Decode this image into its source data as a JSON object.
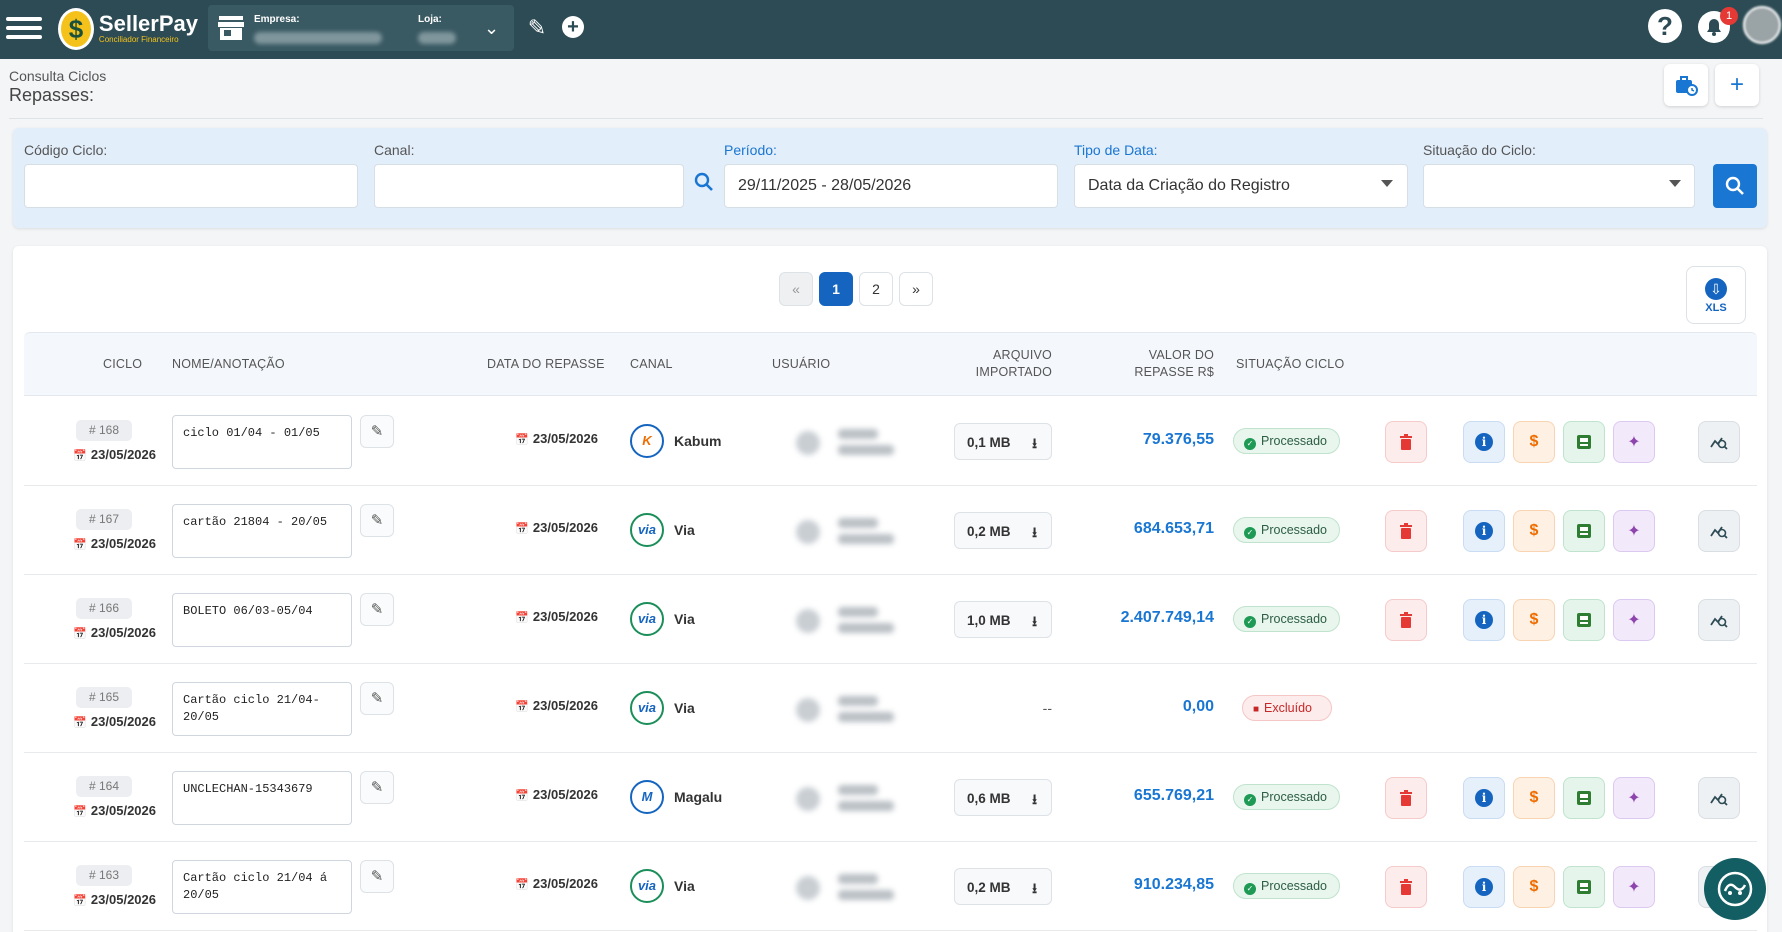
{
  "app": {
    "logo_name": "SellerPay",
    "logo_tagline": "Conciliador Financeiro",
    "empresa_label": "Empresa:",
    "loja_label": "Loja:",
    "notification_count": "1"
  },
  "header": {
    "breadcrumb": "Consulta Ciclos",
    "title": "Repasses:"
  },
  "filters": {
    "codigo_label": "Código Ciclo:",
    "codigo_value": "",
    "canal_label": "Canal:",
    "canal_value": "",
    "periodo_label": "Período:",
    "periodo_value": "29/11/2025 - 28/05/2026",
    "tipo_label": "Tipo de Data:",
    "tipo_value": "Data da Criação do Registro",
    "situacao_label": "Situação do Ciclo:",
    "situacao_value": ""
  },
  "pagination": {
    "prev": "«",
    "pages": [
      "1",
      "2"
    ],
    "next": "»",
    "current": "1"
  },
  "export": {
    "label": "XLS"
  },
  "table": {
    "headers": {
      "ciclo": "CICLO",
      "nome": "NOME/ANOTAÇÃO",
      "data": "DATA DO REPASSE",
      "canal": "CANAL",
      "usuario": "USUÁRIO",
      "arquivo_1": "ARQUIVO",
      "arquivo_2": "IMPORTADO",
      "valor_1": "VALOR DO",
      "valor_2": "REPASSE R$",
      "situacao": "SITUAÇÃO CICLO"
    },
    "rows": [
      {
        "ciclo": "# 168",
        "ciclo_date": "23/05/2026",
        "note": "ciclo 01/04 - 01/05",
        "data": "23/05/2026",
        "canal": "Kabum",
        "arquivo": "0,1 MB",
        "valor": "79.376,55",
        "situacao": "Processado"
      },
      {
        "ciclo": "# 167",
        "ciclo_date": "23/05/2026",
        "note": "cartão 21804 - 20/05",
        "data": "23/05/2026",
        "canal": "Via",
        "arquivo": "0,2 MB",
        "valor": "684.653,71",
        "situacao": "Processado"
      },
      {
        "ciclo": "# 166",
        "ciclo_date": "23/05/2026",
        "note": "BOLETO 06/03-05/04",
        "data": "23/05/2026",
        "canal": "Via",
        "arquivo": "1,0 MB",
        "valor": "2.407.749,14",
        "situacao": "Processado"
      },
      {
        "ciclo": "# 165",
        "ciclo_date": "23/05/2026",
        "note": "Cartão ciclo 21/04-20/05",
        "data": "23/05/2026",
        "canal": "Via",
        "arquivo": "--",
        "valor": "0,00",
        "situacao": "Excluído"
      },
      {
        "ciclo": "# 164",
        "ciclo_date": "23/05/2026",
        "note": "UNCLECHAN-15343679",
        "data": "23/05/2026",
        "canal": "Magalu",
        "arquivo": "0,6 MB",
        "valor": "655.769,21",
        "situacao": "Processado"
      },
      {
        "ciclo": "# 163",
        "ciclo_date": "23/05/2026",
        "note": "Cartão ciclo 21/04 á 20/05",
        "data": "23/05/2026",
        "canal": "Via",
        "arquivo": "0,2 MB",
        "valor": "910.234,85",
        "situacao": "Processado"
      }
    ]
  },
  "colors": {
    "topbar": "#2d4b54",
    "accent": "#1976d2",
    "success": "#1e9a55",
    "danger": "#e53935"
  },
  "icons": [
    "menu-icon",
    "store-icon",
    "pencil-icon",
    "plus-circle-icon",
    "help-icon",
    "bell-icon",
    "calendar-icon",
    "download-icon",
    "trash-icon",
    "info-icon",
    "money-icon",
    "sheet-icon",
    "sparkle-icon",
    "chart-search-icon",
    "chat-icon"
  ]
}
